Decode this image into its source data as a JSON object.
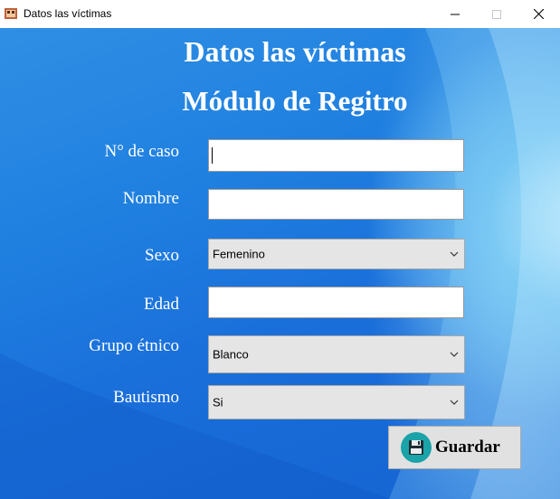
{
  "window": {
    "title": "Datos las víctimas"
  },
  "header": {
    "title": "Datos las víctimas",
    "subtitle": "Módulo de Regitro"
  },
  "form": {
    "case_number": {
      "label": "N° de caso",
      "value": ""
    },
    "name": {
      "label": "Nombre",
      "value": ""
    },
    "sex": {
      "label": "Sexo",
      "selected": "Femenino"
    },
    "age": {
      "label": "Edad",
      "value": ""
    },
    "ethnic_group": {
      "label": "Grupo étnico",
      "selected": "Blanco"
    },
    "baptism": {
      "label": "Bautismo",
      "selected": "Si"
    }
  },
  "actions": {
    "save_label": "Guardar"
  },
  "icons": {
    "app": "app-icon",
    "minimize": "minimize-icon",
    "maximize": "maximize-icon",
    "close": "close-icon",
    "dropdown": "chevron-down-icon",
    "save": "floppy-disk-icon"
  },
  "colors": {
    "background": "#1f7fe0",
    "save_icon": "#1aa3a8"
  }
}
